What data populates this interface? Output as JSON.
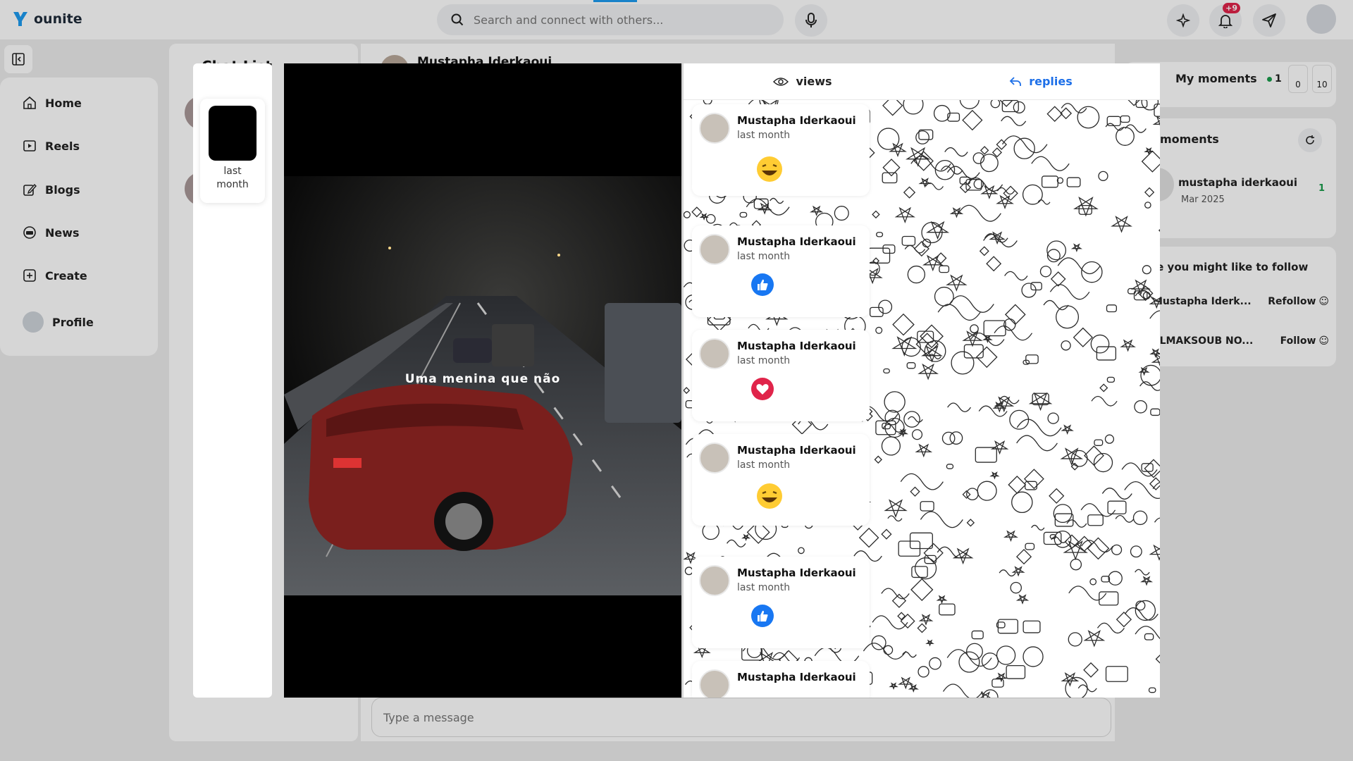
{
  "app": {
    "name": "ounite"
  },
  "search": {
    "placeholder": "Search and connect with others..."
  },
  "notifications": {
    "badge": "+9"
  },
  "nav": {
    "items": [
      {
        "label": "Home",
        "icon": "home-icon"
      },
      {
        "label": "Reels",
        "icon": "reels-icon"
      },
      {
        "label": "Blogs",
        "icon": "blogs-icon"
      },
      {
        "label": "News",
        "icon": "news-icon"
      },
      {
        "label": "Create",
        "icon": "create-icon"
      },
      {
        "label": "Profile",
        "icon": "avatar"
      }
    ]
  },
  "chat": {
    "list_title": "Chat List",
    "header_name": "Mustapha Iderkaoui",
    "input_placeholder": "Type a message"
  },
  "my_moments": {
    "label": "My moments",
    "active_count": "1",
    "views": "0",
    "replies": "10"
  },
  "moments": {
    "title": "moments",
    "item": {
      "name": "mustapha iderkaoui",
      "date": "Mar 2025",
      "count": "1"
    }
  },
  "suggestions": {
    "title": "le you might like to follow",
    "people": [
      {
        "name": "Mustapha Iderk...",
        "action": "Refollow"
      },
      {
        "name": "ELMAKSOUB NO...",
        "action": "Follow"
      }
    ]
  },
  "story": {
    "thumb_time": "last month",
    "caption": "Uma menina que não",
    "tabs": {
      "views": "views",
      "replies": "replies"
    },
    "replies": [
      {
        "name": "Mustapha Iderkaoui",
        "time": "last month",
        "reaction": "laugh"
      },
      {
        "name": "Mustapha Iderkaoui",
        "time": "last month",
        "reaction": "like"
      },
      {
        "name": "Mustapha Iderkaoui",
        "time": "last month",
        "reaction": "love"
      },
      {
        "name": "Mustapha Iderkaoui",
        "time": "last month",
        "reaction": "laugh"
      },
      {
        "name": "Mustapha Iderkaoui",
        "time": "last month",
        "reaction": "like"
      },
      {
        "name": "Mustapha Iderkaoui",
        "time": "",
        "reaction": ""
      }
    ]
  },
  "colors": {
    "accent": "#1d9bf0",
    "replies_tab": "#1d6fe8",
    "like": "#1877f2",
    "love": "#e0244a",
    "online": "#1a9c4c"
  }
}
